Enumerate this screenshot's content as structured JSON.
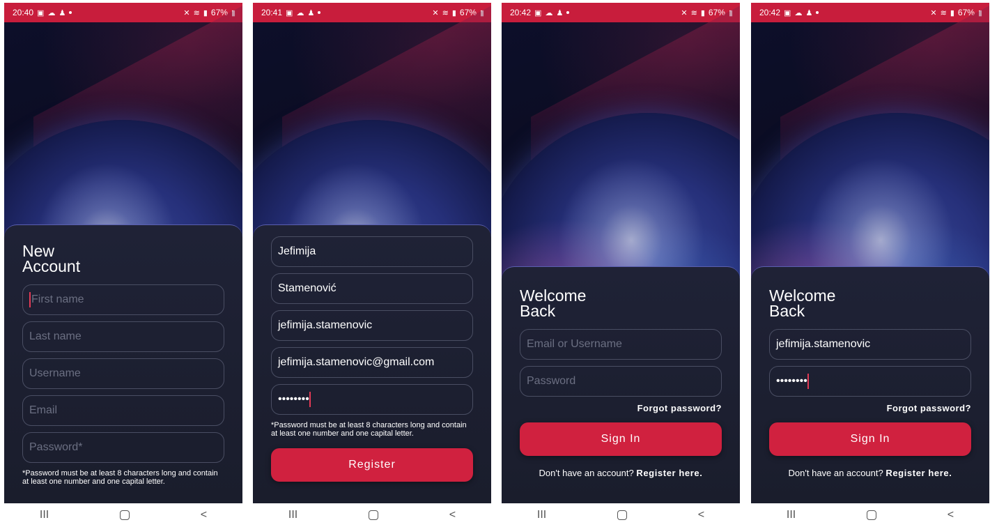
{
  "status": {
    "times": [
      "20:40",
      "20:41",
      "20:42",
      "20:42"
    ],
    "battery": "67%"
  },
  "register_empty": {
    "title_line1": "New",
    "title_line2": "Account",
    "first_name_placeholder": "First name",
    "last_name_placeholder": "Last name",
    "username_placeholder": "Username",
    "email_placeholder": "Email",
    "password_placeholder": "Password*",
    "password_note": "*Password must be at least 8 characters long and contain at least one number and one capital letter."
  },
  "register_filled": {
    "first_name": "Jefimija",
    "last_name": "Stamenović",
    "username": "jefimija.stamenovic",
    "email": "jefimija.stamenovic@gmail.com",
    "password_mask": "••••••••",
    "password_note": "*Password must be at least 8 characters long and contain at least one number and one capital letter.",
    "register_button": "Register"
  },
  "login_empty": {
    "title_line1": "Welcome",
    "title_line2": "Back",
    "user_placeholder": "Email or Username",
    "password_placeholder": "Password",
    "forgot": "Forgot password?",
    "sign_in": "Sign In",
    "register_prompt": "Don't have an account?",
    "register_link": "Register here."
  },
  "login_filled": {
    "title_line1": "Welcome",
    "title_line2": "Back",
    "username": "jefimija.stamenovic",
    "password_mask": "••••••••",
    "forgot": "Forgot password?",
    "sign_in": "Sign In",
    "register_prompt": "Don't have an account?",
    "register_link": "Register here."
  },
  "navbar": {
    "recents": "III",
    "back": "<"
  },
  "colors": {
    "status_bar": "#c81d3c",
    "primary": "#d0213f",
    "panel": "#1d2030",
    "panel_border": "#5a5fb0"
  },
  "icons": [
    "photo-icon",
    "cloud-icon",
    "accessibility-icon",
    "mute-icon",
    "wifi-icon",
    "signal-icon",
    "battery-icon"
  ]
}
